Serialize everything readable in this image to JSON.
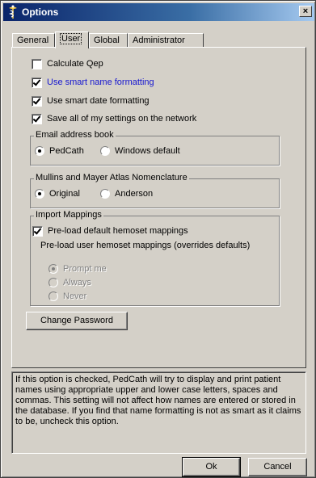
{
  "window": {
    "title": "Options",
    "close_glyph": "×"
  },
  "tabs": [
    {
      "label": "General"
    },
    {
      "label": "User"
    },
    {
      "label": "Global"
    },
    {
      "label": "Administrator"
    }
  ],
  "options": {
    "calculate_qep": {
      "label": "Calculate Qep",
      "checked": false
    },
    "smart_name": {
      "label": "Use smart name formatting",
      "checked": true
    },
    "smart_date": {
      "label": "Use smart date formatting",
      "checked": true
    },
    "save_settings": {
      "label": "Save all of my settings on the network",
      "checked": true
    }
  },
  "email_group": {
    "title": "Email address book",
    "options": [
      {
        "label": "PedCath",
        "checked": true
      },
      {
        "label": "Windows default",
        "checked": false
      }
    ]
  },
  "atlas_group": {
    "title": "Mullins and Mayer Atlas Nomenclature",
    "options": [
      {
        "label": "Original",
        "checked": true
      },
      {
        "label": "Anderson",
        "checked": false
      }
    ]
  },
  "import_group": {
    "title": "Import Mappings",
    "preload_default": {
      "label": "Pre-load default hemoset mappings",
      "checked": true
    },
    "preload_user_label": "Pre-load user hemoset mappings (overrides defaults)",
    "options": [
      {
        "label": "Prompt me",
        "checked": true
      },
      {
        "label": "Always",
        "checked": false
      },
      {
        "label": "Never",
        "checked": false
      }
    ]
  },
  "buttons": {
    "change_password": "Change Password",
    "ok": "Ok",
    "cancel": "Cancel"
  },
  "help_text": "If this option is checked, PedCath will try to display and print patient names using appropriate upper and lower case letters, spaces and commas. This setting will not affect how names are entered or stored in the database. If you find that name formatting is not as smart as it claims to be, uncheck this option.",
  "colors": {
    "title_bar_start": "#0a246a",
    "title_bar_end": "#a6caf0",
    "highlight_text": "#1515d0",
    "face": "#d4d0c8"
  }
}
